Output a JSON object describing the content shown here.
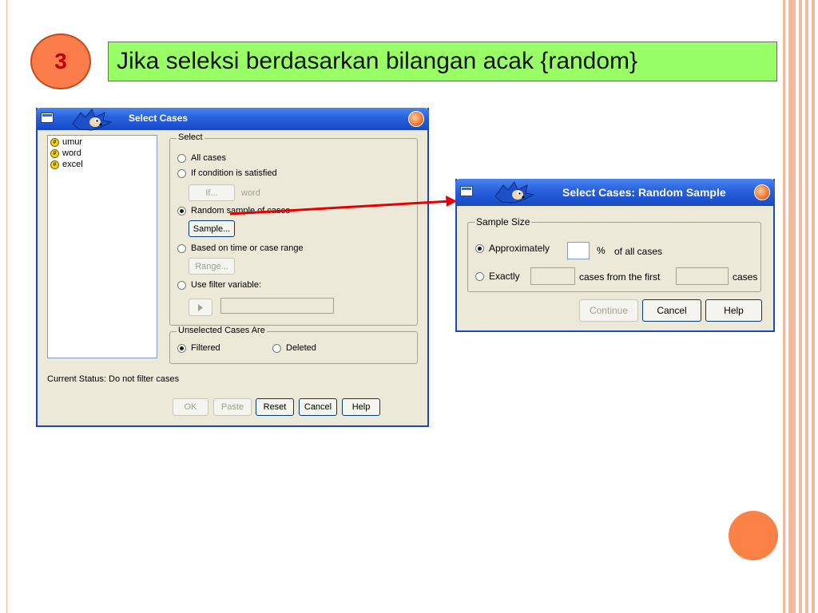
{
  "slide": {
    "step_number": "3",
    "heading": "Jika seleksi berdasarkan bilangan acak {random}",
    "colors": {
      "title_box": "#99ff66",
      "circle": "#fb7e4a",
      "accent_line": "#f4b89c",
      "arrow": "#e60000"
    }
  },
  "select_cases": {
    "title": "Select Cases",
    "variables": [
      {
        "name": "umur",
        "icon": "scale-variable-icon"
      },
      {
        "name": "word",
        "icon": "scale-variable-icon"
      },
      {
        "name": "excel",
        "icon": "scale-variable-icon"
      }
    ],
    "select_group": {
      "legend": "Select",
      "all_cases": "All cases",
      "if_condition": "If condition is satisfied",
      "if_button": "If...",
      "if_value": "word",
      "random_sample": "Random sample of cases",
      "sample_button": "Sample...",
      "time_range": "Based on time or case range",
      "range_button": "Range...",
      "filter_variable": "Use filter variable:",
      "selected": "random_sample"
    },
    "unselected_group": {
      "legend": "Unselected Cases Are",
      "filtered": "Filtered",
      "deleted": "Deleted",
      "selected": "filtered"
    },
    "status": "Current Status: Do not filter cases",
    "buttons": {
      "ok": "OK",
      "paste": "Paste",
      "reset": "Reset",
      "cancel": "Cancel",
      "help": "Help"
    }
  },
  "random_sample": {
    "title": "Select Cases: Random Sample",
    "legend": "Sample Size",
    "approximately": "Approximately",
    "percent_sign": "%",
    "of_all_cases": "of all cases",
    "exactly": "Exactly",
    "cases_from_first": "cases from the first",
    "cases": "cases",
    "selected": "approximately",
    "buttons": {
      "continue": "Continue",
      "cancel": "Cancel",
      "help": "Help"
    }
  }
}
